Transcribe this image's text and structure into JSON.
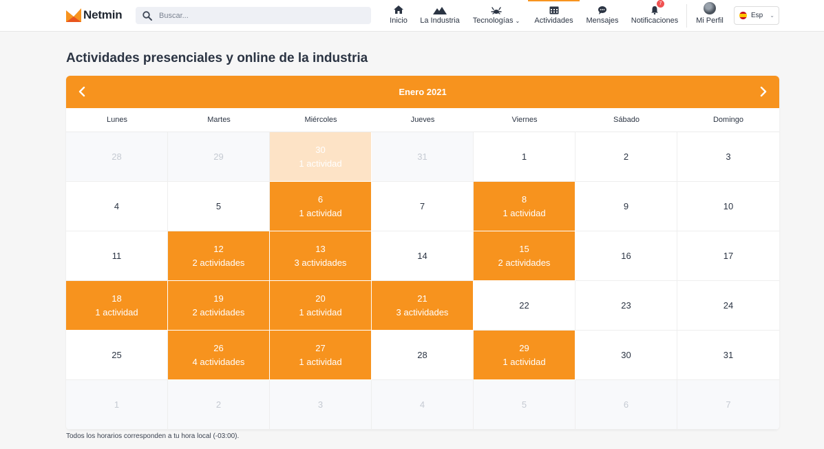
{
  "header": {
    "brand": "Netmin",
    "search_placeholder": "Buscar...",
    "nav": [
      {
        "label": "Inicio",
        "icon": "home-icon"
      },
      {
        "label": "La Industria",
        "icon": "mountain-icon"
      },
      {
        "label": "Tecnologías",
        "icon": "crab-icon"
      },
      {
        "label": "Actividades",
        "icon": "calendar-icon"
      },
      {
        "label": "Mensajes",
        "icon": "chat-icon"
      },
      {
        "label": "Notificaciones",
        "icon": "bell-icon",
        "badge": "7"
      },
      {
        "label": "Mi Perfil",
        "icon": "avatar"
      }
    ],
    "language": "Esp"
  },
  "page": {
    "title": "Actividades presenciales y online de la industria",
    "footnote": "Todos los horarios corresponden a tu hora local (-03:00)."
  },
  "calendar": {
    "month_label": "Enero 2021",
    "weekdays": [
      "Lunes",
      "Martes",
      "Miércoles",
      "Jueves",
      "Viernes",
      "Sábado",
      "Domingo"
    ],
    "days": [
      {
        "day": "28",
        "count": "",
        "muted": true,
        "active": false
      },
      {
        "day": "29",
        "count": "",
        "muted": true,
        "active": false
      },
      {
        "day": "30",
        "count": "1 actividad",
        "muted": true,
        "active": true
      },
      {
        "day": "31",
        "count": "",
        "muted": true,
        "active": false
      },
      {
        "day": "1",
        "count": "",
        "muted": false,
        "active": false
      },
      {
        "day": "2",
        "count": "",
        "muted": false,
        "active": false
      },
      {
        "day": "3",
        "count": "",
        "muted": false,
        "active": false
      },
      {
        "day": "4",
        "count": "",
        "muted": false,
        "active": false
      },
      {
        "day": "5",
        "count": "",
        "muted": false,
        "active": false
      },
      {
        "day": "6",
        "count": "1 actividad",
        "muted": false,
        "active": true
      },
      {
        "day": "7",
        "count": "",
        "muted": false,
        "active": false
      },
      {
        "day": "8",
        "count": "1 actividad",
        "muted": false,
        "active": true
      },
      {
        "day": "9",
        "count": "",
        "muted": false,
        "active": false
      },
      {
        "day": "10",
        "count": "",
        "muted": false,
        "active": false
      },
      {
        "day": "11",
        "count": "",
        "muted": false,
        "active": false
      },
      {
        "day": "12",
        "count": "2 actividades",
        "muted": false,
        "active": true
      },
      {
        "day": "13",
        "count": "3 actividades",
        "muted": false,
        "active": true
      },
      {
        "day": "14",
        "count": "",
        "muted": false,
        "active": false
      },
      {
        "day": "15",
        "count": "2 actividades",
        "muted": false,
        "active": true
      },
      {
        "day": "16",
        "count": "",
        "muted": false,
        "active": false
      },
      {
        "day": "17",
        "count": "",
        "muted": false,
        "active": false
      },
      {
        "day": "18",
        "count": "1 actividad",
        "muted": false,
        "active": true
      },
      {
        "day": "19",
        "count": "2 actividades",
        "muted": false,
        "active": true
      },
      {
        "day": "20",
        "count": "1 actividad",
        "muted": false,
        "active": true
      },
      {
        "day": "21",
        "count": "3 actividades",
        "muted": false,
        "active": true
      },
      {
        "day": "22",
        "count": "",
        "muted": false,
        "active": false
      },
      {
        "day": "23",
        "count": "",
        "muted": false,
        "active": false
      },
      {
        "day": "24",
        "count": "",
        "muted": false,
        "active": false
      },
      {
        "day": "25",
        "count": "",
        "muted": false,
        "active": false
      },
      {
        "day": "26",
        "count": "4 actividades",
        "muted": false,
        "active": true
      },
      {
        "day": "27",
        "count": "1 actividad",
        "muted": false,
        "active": true
      },
      {
        "day": "28",
        "count": "",
        "muted": false,
        "active": false
      },
      {
        "day": "29",
        "count": "1 actividad",
        "muted": false,
        "active": true
      },
      {
        "day": "30",
        "count": "",
        "muted": false,
        "active": false
      },
      {
        "day": "31",
        "count": "",
        "muted": false,
        "active": false
      },
      {
        "day": "1",
        "count": "",
        "muted": true,
        "active": false
      },
      {
        "day": "2",
        "count": "",
        "muted": true,
        "active": false
      },
      {
        "day": "3",
        "count": "",
        "muted": true,
        "active": false
      },
      {
        "day": "4",
        "count": "",
        "muted": true,
        "active": false
      },
      {
        "day": "5",
        "count": "",
        "muted": true,
        "active": false
      },
      {
        "day": "6",
        "count": "",
        "muted": true,
        "active": false
      },
      {
        "day": "7",
        "count": "",
        "muted": true,
        "active": false
      }
    ]
  },
  "colors": {
    "accent": "#f7931e",
    "accent_light": "#fde3c6",
    "badge": "#f05252"
  }
}
